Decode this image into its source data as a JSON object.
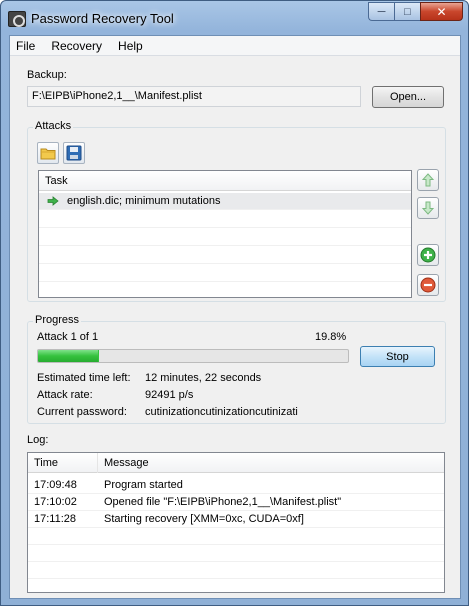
{
  "window": {
    "title": "Password Recovery Tool"
  },
  "menu": {
    "items": [
      "File",
      "Recovery",
      "Help"
    ]
  },
  "backup": {
    "label": "Backup:",
    "path": "F:\\EIPB\\iPhone2,1__\\Manifest.plist",
    "open_label": "Open..."
  },
  "attacks": {
    "title": "Attacks",
    "column": "Task",
    "tasks": [
      "english.dic; minimum mutations"
    ]
  },
  "progress": {
    "title": "Progress",
    "attack_label": "Attack 1 of 1",
    "percent_label": "19.8%",
    "fraction": 0.198,
    "stop_label": "Stop",
    "est_label": "Estimated time left:",
    "est_value": "12 minutes, 22 seconds",
    "rate_label": "Attack rate:",
    "rate_value": "92491 p/s",
    "pw_label": "Current password:",
    "pw_value": "cutinizationcutinizationcutinizati"
  },
  "log": {
    "label": "Log:",
    "columns": [
      "Time",
      "Message"
    ],
    "rows": [
      {
        "time": "17:09:48",
        "message": "Program started"
      },
      {
        "time": "17:10:02",
        "message": "Opened file \"F:\\EIPB\\iPhone2,1__\\Manifest.plist\""
      },
      {
        "time": "17:11:28",
        "message": "Starting recovery [XMM=0xc, CUDA=0xf]"
      }
    ]
  },
  "colors": {
    "progress_fill": "#35c23e",
    "titlebar": "#a9c6e6",
    "close_button": "#c9462c"
  }
}
